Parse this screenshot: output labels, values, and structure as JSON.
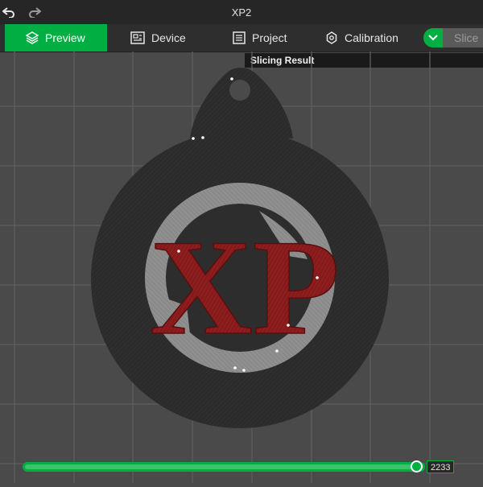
{
  "window": {
    "title": "XP2"
  },
  "tabs": [
    {
      "label": "Preview",
      "icon": "layers-icon",
      "active": true
    },
    {
      "label": "Device",
      "icon": "device-icon",
      "active": false
    },
    {
      "label": "Project",
      "icon": "project-icon",
      "active": false
    },
    {
      "label": "Calibration",
      "icon": "calibration-icon",
      "active": false
    }
  ],
  "slice": {
    "label": "Slice"
  },
  "tooltip": {
    "text": "Slicing Result"
  },
  "model": {
    "logo_text": "XP"
  },
  "layer_slider": {
    "value": "2233",
    "progress": 0.97
  },
  "colors": {
    "accent": "#00ae42",
    "model_body": "#2f2f2f",
    "logo_red": "#8e1c1c",
    "ring_gray": "#8f8f8f",
    "grid": "#5e5e5e"
  }
}
